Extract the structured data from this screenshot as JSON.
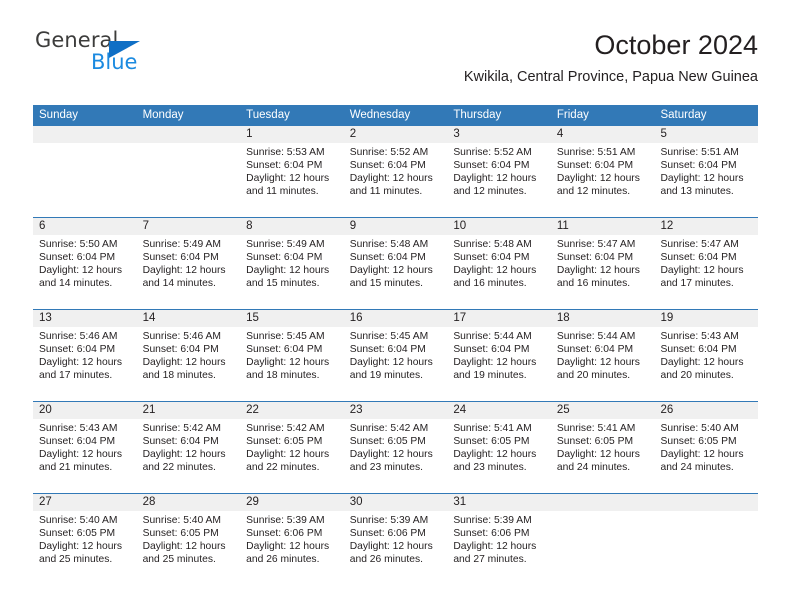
{
  "brand": {
    "name_top": "General",
    "name_bottom": "Blue",
    "triangle_color": "#0f6fc5",
    "blue_color": "#1b8ae0"
  },
  "header": {
    "title": "October 2024",
    "location": "Kwikila, Central Province, Papua New Guinea"
  },
  "theme": {
    "header_blue": "#3279b7",
    "day_band_gray": "#f0f0f0",
    "text": "#231f20"
  },
  "calendar": {
    "weekdays": [
      "Sunday",
      "Monday",
      "Tuesday",
      "Wednesday",
      "Thursday",
      "Friday",
      "Saturday"
    ],
    "weeks": [
      [
        {
          "day": "",
          "sunrise": "",
          "sunset": "",
          "daylight": ""
        },
        {
          "day": "",
          "sunrise": "",
          "sunset": "",
          "daylight": ""
        },
        {
          "day": "1",
          "sunrise": "Sunrise: 5:53 AM",
          "sunset": "Sunset: 6:04 PM",
          "daylight": "Daylight: 12 hours and 11 minutes."
        },
        {
          "day": "2",
          "sunrise": "Sunrise: 5:52 AM",
          "sunset": "Sunset: 6:04 PM",
          "daylight": "Daylight: 12 hours and 11 minutes."
        },
        {
          "day": "3",
          "sunrise": "Sunrise: 5:52 AM",
          "sunset": "Sunset: 6:04 PM",
          "daylight": "Daylight: 12 hours and 12 minutes."
        },
        {
          "day": "4",
          "sunrise": "Sunrise: 5:51 AM",
          "sunset": "Sunset: 6:04 PM",
          "daylight": "Daylight: 12 hours and 12 minutes."
        },
        {
          "day": "5",
          "sunrise": "Sunrise: 5:51 AM",
          "sunset": "Sunset: 6:04 PM",
          "daylight": "Daylight: 12 hours and 13 minutes."
        }
      ],
      [
        {
          "day": "6",
          "sunrise": "Sunrise: 5:50 AM",
          "sunset": "Sunset: 6:04 PM",
          "daylight": "Daylight: 12 hours and 14 minutes."
        },
        {
          "day": "7",
          "sunrise": "Sunrise: 5:49 AM",
          "sunset": "Sunset: 6:04 PM",
          "daylight": "Daylight: 12 hours and 14 minutes."
        },
        {
          "day": "8",
          "sunrise": "Sunrise: 5:49 AM",
          "sunset": "Sunset: 6:04 PM",
          "daylight": "Daylight: 12 hours and 15 minutes."
        },
        {
          "day": "9",
          "sunrise": "Sunrise: 5:48 AM",
          "sunset": "Sunset: 6:04 PM",
          "daylight": "Daylight: 12 hours and 15 minutes."
        },
        {
          "day": "10",
          "sunrise": "Sunrise: 5:48 AM",
          "sunset": "Sunset: 6:04 PM",
          "daylight": "Daylight: 12 hours and 16 minutes."
        },
        {
          "day": "11",
          "sunrise": "Sunrise: 5:47 AM",
          "sunset": "Sunset: 6:04 PM",
          "daylight": "Daylight: 12 hours and 16 minutes."
        },
        {
          "day": "12",
          "sunrise": "Sunrise: 5:47 AM",
          "sunset": "Sunset: 6:04 PM",
          "daylight": "Daylight: 12 hours and 17 minutes."
        }
      ],
      [
        {
          "day": "13",
          "sunrise": "Sunrise: 5:46 AM",
          "sunset": "Sunset: 6:04 PM",
          "daylight": "Daylight: 12 hours and 17 minutes."
        },
        {
          "day": "14",
          "sunrise": "Sunrise: 5:46 AM",
          "sunset": "Sunset: 6:04 PM",
          "daylight": "Daylight: 12 hours and 18 minutes."
        },
        {
          "day": "15",
          "sunrise": "Sunrise: 5:45 AM",
          "sunset": "Sunset: 6:04 PM",
          "daylight": "Daylight: 12 hours and 18 minutes."
        },
        {
          "day": "16",
          "sunrise": "Sunrise: 5:45 AM",
          "sunset": "Sunset: 6:04 PM",
          "daylight": "Daylight: 12 hours and 19 minutes."
        },
        {
          "day": "17",
          "sunrise": "Sunrise: 5:44 AM",
          "sunset": "Sunset: 6:04 PM",
          "daylight": "Daylight: 12 hours and 19 minutes."
        },
        {
          "day": "18",
          "sunrise": "Sunrise: 5:44 AM",
          "sunset": "Sunset: 6:04 PM",
          "daylight": "Daylight: 12 hours and 20 minutes."
        },
        {
          "day": "19",
          "sunrise": "Sunrise: 5:43 AM",
          "sunset": "Sunset: 6:04 PM",
          "daylight": "Daylight: 12 hours and 20 minutes."
        }
      ],
      [
        {
          "day": "20",
          "sunrise": "Sunrise: 5:43 AM",
          "sunset": "Sunset: 6:04 PM",
          "daylight": "Daylight: 12 hours and 21 minutes."
        },
        {
          "day": "21",
          "sunrise": "Sunrise: 5:42 AM",
          "sunset": "Sunset: 6:04 PM",
          "daylight": "Daylight: 12 hours and 22 minutes."
        },
        {
          "day": "22",
          "sunrise": "Sunrise: 5:42 AM",
          "sunset": "Sunset: 6:05 PM",
          "daylight": "Daylight: 12 hours and 22 minutes."
        },
        {
          "day": "23",
          "sunrise": "Sunrise: 5:42 AM",
          "sunset": "Sunset: 6:05 PM",
          "daylight": "Daylight: 12 hours and 23 minutes."
        },
        {
          "day": "24",
          "sunrise": "Sunrise: 5:41 AM",
          "sunset": "Sunset: 6:05 PM",
          "daylight": "Daylight: 12 hours and 23 minutes."
        },
        {
          "day": "25",
          "sunrise": "Sunrise: 5:41 AM",
          "sunset": "Sunset: 6:05 PM",
          "daylight": "Daylight: 12 hours and 24 minutes."
        },
        {
          "day": "26",
          "sunrise": "Sunrise: 5:40 AM",
          "sunset": "Sunset: 6:05 PM",
          "daylight": "Daylight: 12 hours and 24 minutes."
        }
      ],
      [
        {
          "day": "27",
          "sunrise": "Sunrise: 5:40 AM",
          "sunset": "Sunset: 6:05 PM",
          "daylight": "Daylight: 12 hours and 25 minutes."
        },
        {
          "day": "28",
          "sunrise": "Sunrise: 5:40 AM",
          "sunset": "Sunset: 6:05 PM",
          "daylight": "Daylight: 12 hours and 25 minutes."
        },
        {
          "day": "29",
          "sunrise": "Sunrise: 5:39 AM",
          "sunset": "Sunset: 6:06 PM",
          "daylight": "Daylight: 12 hours and 26 minutes."
        },
        {
          "day": "30",
          "sunrise": "Sunrise: 5:39 AM",
          "sunset": "Sunset: 6:06 PM",
          "daylight": "Daylight: 12 hours and 26 minutes."
        },
        {
          "day": "31",
          "sunrise": "Sunrise: 5:39 AM",
          "sunset": "Sunset: 6:06 PM",
          "daylight": "Daylight: 12 hours and 27 minutes."
        },
        {
          "day": "",
          "sunrise": "",
          "sunset": "",
          "daylight": ""
        },
        {
          "day": "",
          "sunrise": "",
          "sunset": "",
          "daylight": ""
        }
      ]
    ]
  }
}
